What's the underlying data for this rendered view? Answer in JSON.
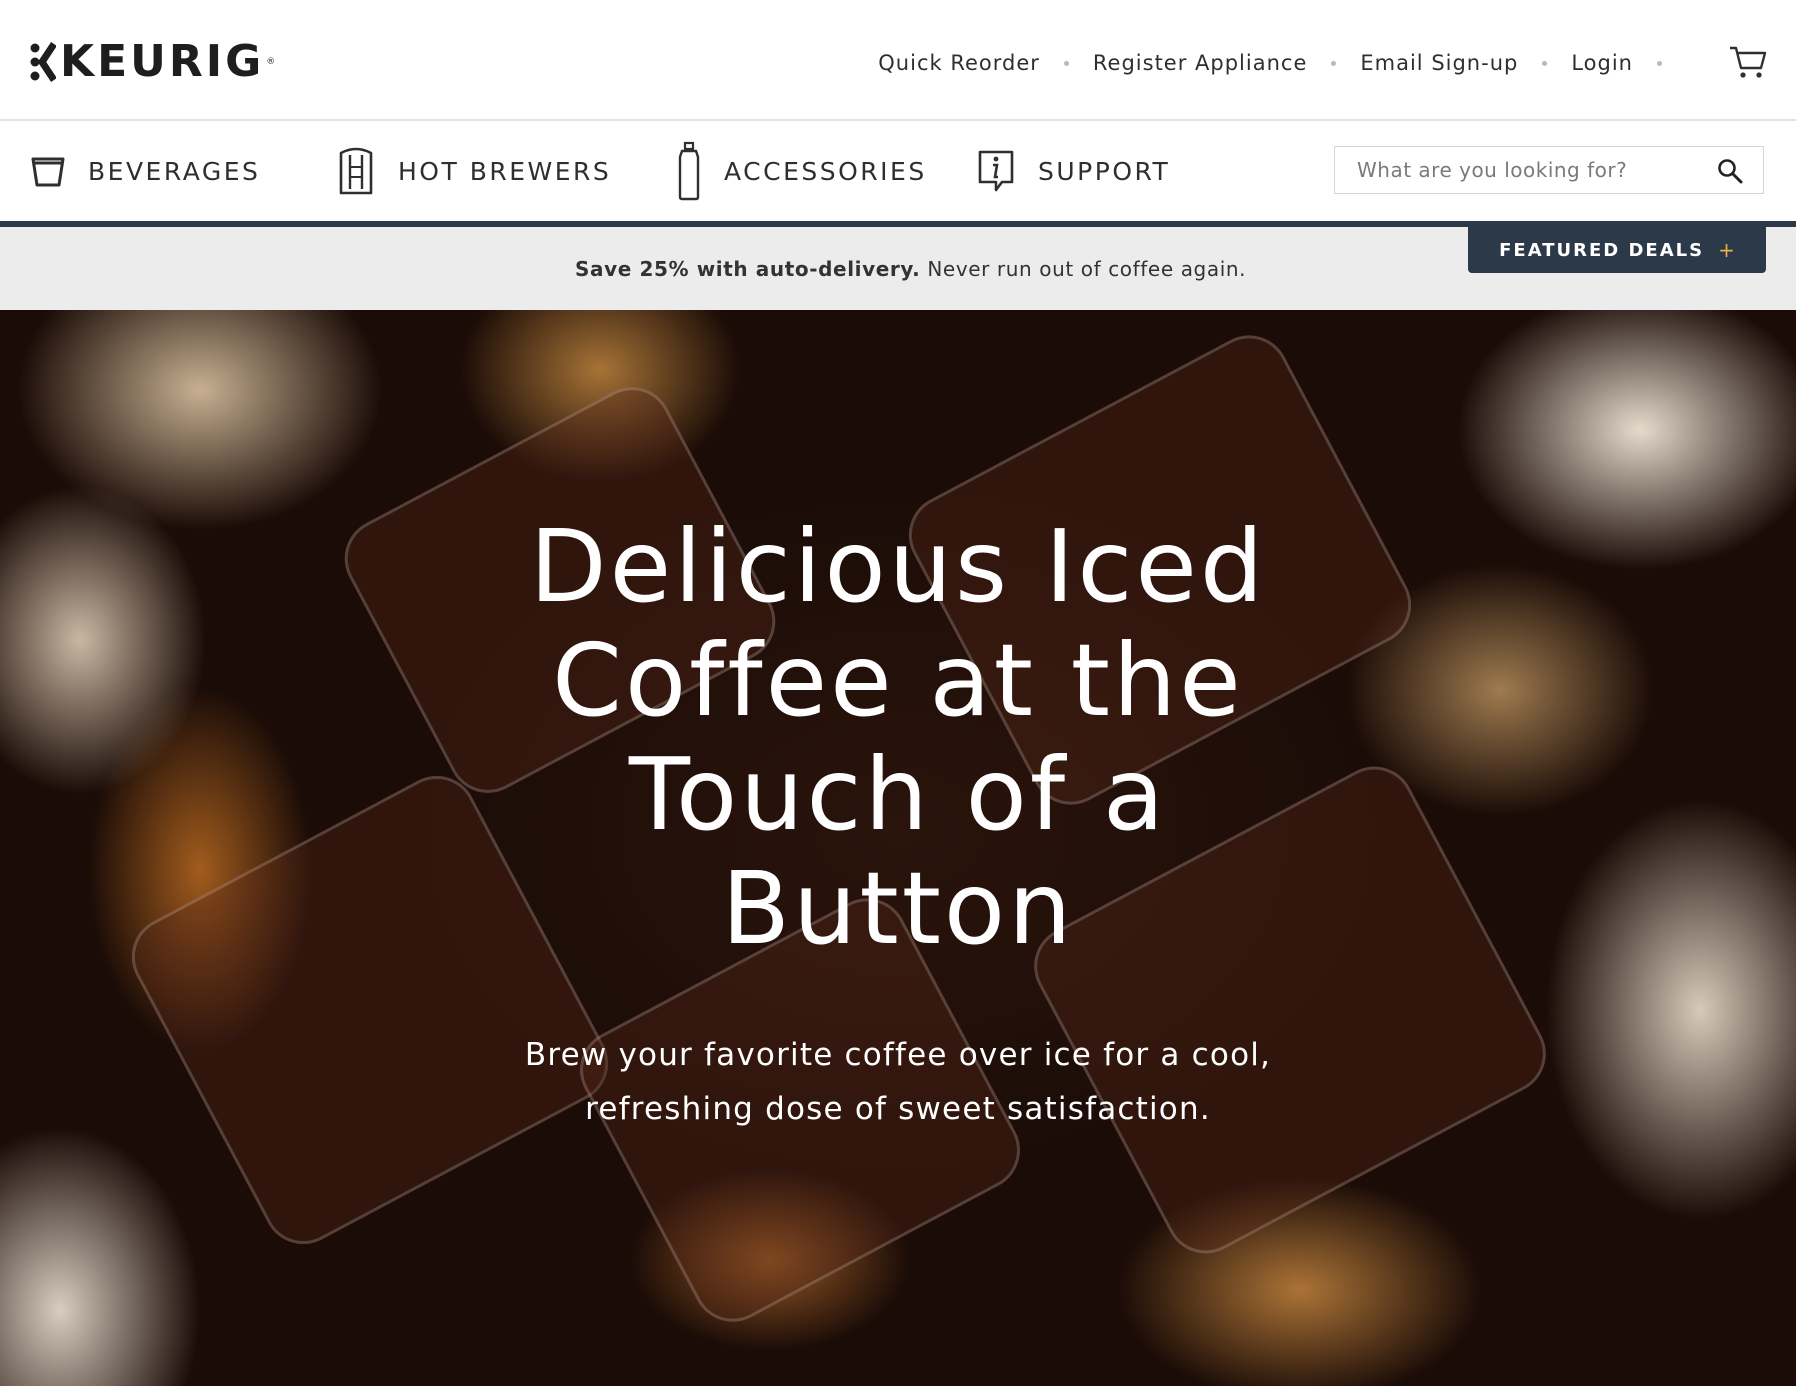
{
  "brand": {
    "name": "KEURIG",
    "registered_mark": "®"
  },
  "utility_nav": {
    "links": [
      {
        "label": "Quick Reorder"
      },
      {
        "label": "Register Appliance"
      },
      {
        "label": "Email Sign-up"
      },
      {
        "label": "Login"
      }
    ],
    "cart_icon": "shopping-cart-icon"
  },
  "main_nav": {
    "items": [
      {
        "label": "BEVERAGES",
        "icon": "cup-icon"
      },
      {
        "label": "HOT BREWERS",
        "icon": "brewer-icon"
      },
      {
        "label": "ACCESSORIES",
        "icon": "bottle-icon"
      },
      {
        "label": "SUPPORT",
        "icon": "info-bubble-icon"
      }
    ],
    "search": {
      "placeholder": "What are you looking for?",
      "value": "",
      "icon": "search-icon"
    },
    "accent_color": "#2c3949"
  },
  "promo": {
    "strong_text": "Save 25% with auto-delivery.",
    "text": " Never run out of coffee again.",
    "deals_label": "FEATURED DEALS",
    "deals_symbol": "+",
    "deals_bg": "#2c3949",
    "deals_accent": "#e8b04a"
  },
  "hero": {
    "title": "Delicious Iced Coffee at the Touch of a Button",
    "subtitle": "Brew your favorite coffee over ice for a cool, refreshing dose of sweet satisfaction."
  }
}
